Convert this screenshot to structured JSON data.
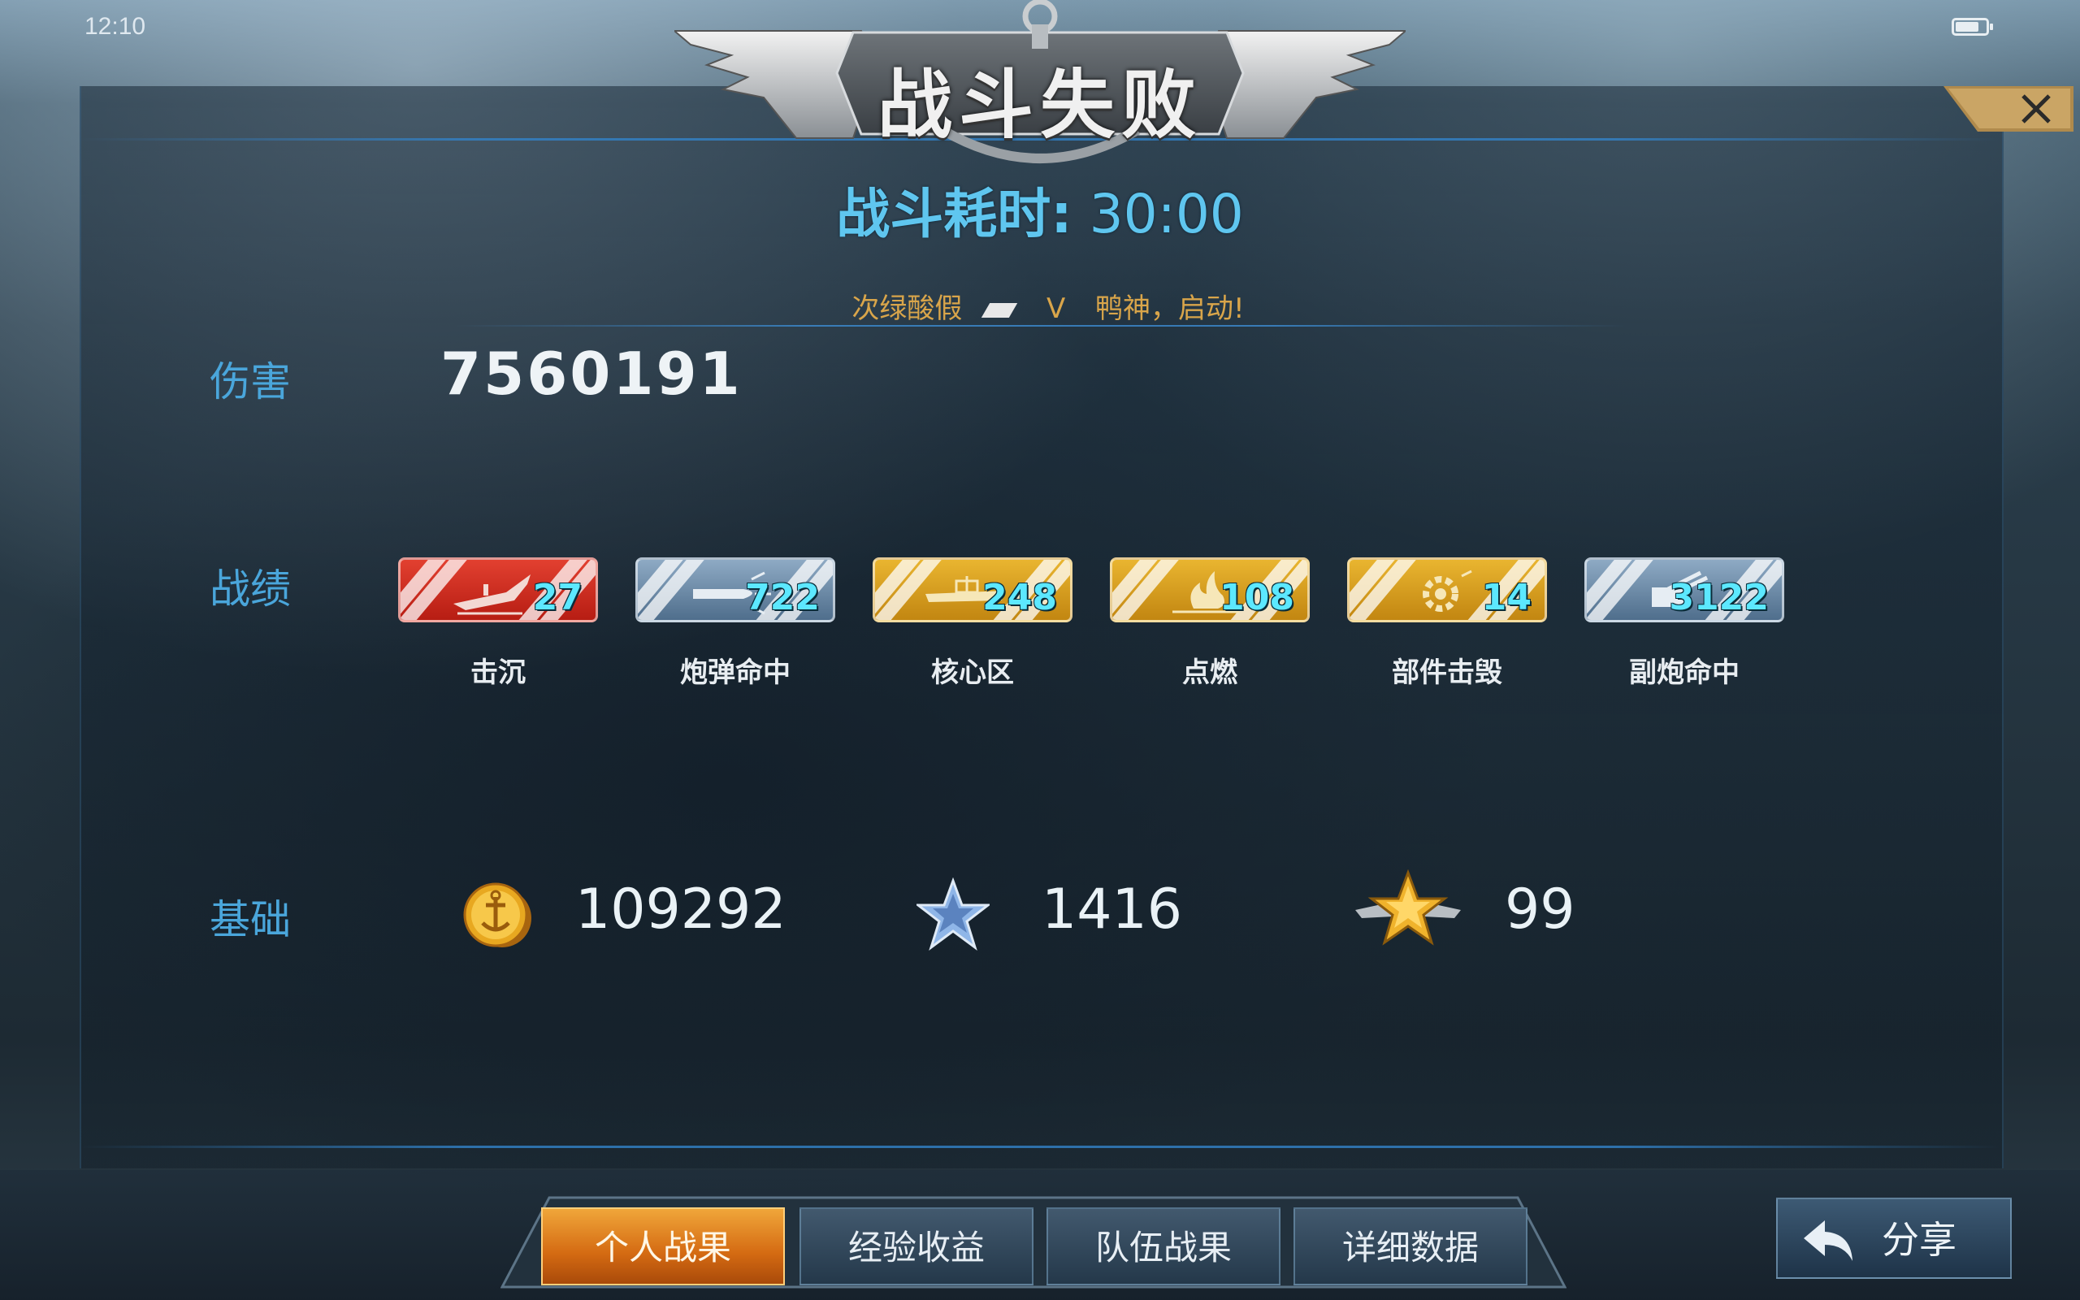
{
  "status_bar": {
    "time": "12:10"
  },
  "banner": {
    "title": "战斗失败"
  },
  "timer": {
    "label": "战斗耗时:",
    "value": "30:00"
  },
  "players": {
    "left": "次绿酸假",
    "vs": "V",
    "right": "鸭神，启动!"
  },
  "damage": {
    "label": "伤害",
    "value": "7560191"
  },
  "record": {
    "label": "战绩",
    "badges": [
      {
        "name": "击沉",
        "value": "27",
        "color": "#d8321f",
        "icon": "sinking-ship-icon"
      },
      {
        "name": "炮弹命中",
        "value": "722",
        "color": "#6c8aa8",
        "icon": "shell-icon"
      },
      {
        "name": "核心区",
        "value": "248",
        "color": "#d89d1c",
        "icon": "ship-core-icon"
      },
      {
        "name": "点燃",
        "value": "108",
        "color": "#d89d1c",
        "icon": "fire-icon"
      },
      {
        "name": "部件击毁",
        "value": "14",
        "color": "#d89d1c",
        "icon": "gear-icon"
      },
      {
        "name": "副炮命中",
        "value": "3122",
        "color": "#6c8aa8",
        "icon": "secondary-gun-icon"
      }
    ]
  },
  "basic": {
    "label": "基础",
    "coins": "109292",
    "stars": "1416",
    "rank": "99"
  },
  "tabs": [
    "个人战果",
    "经验收益",
    "队伍战果",
    "详细数据"
  ],
  "active_tab": "个人战果",
  "share": {
    "label": "分享"
  }
}
